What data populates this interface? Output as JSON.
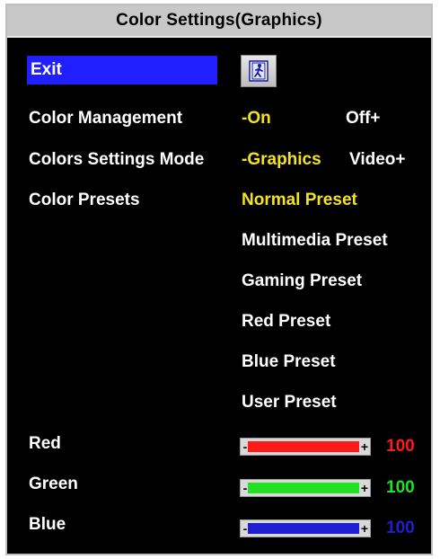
{
  "window": {
    "title": "Color Settings(Graphics)"
  },
  "menu": {
    "exit_label": "Exit",
    "exit_icon": "exit-door-icon",
    "color_management": {
      "label": "Color Management",
      "options": [
        "-On",
        "Off+"
      ],
      "selected": "-On"
    },
    "color_settings_mode": {
      "label": "Colors Settings Mode",
      "options": [
        "-Graphics",
        "Video+"
      ],
      "selected": "-Graphics"
    },
    "color_presets": {
      "label": "Color Presets",
      "options": [
        "Normal Preset",
        "Multimedia Preset",
        "Gaming Preset",
        "Red Preset",
        "Blue Preset",
        "User Preset"
      ],
      "selected": "Normal Preset"
    }
  },
  "rgb": {
    "red": {
      "label": "Red",
      "value": "100",
      "level": 1.0,
      "color": "#ff1a1a"
    },
    "green": {
      "label": "Green",
      "value": "100",
      "level": 1.0,
      "color": "#22e022"
    },
    "blue": {
      "label": "Blue",
      "value": "100",
      "level": 1.0,
      "color": "#1f1fcf"
    },
    "minus_glyph": "-",
    "plus_glyph": "+"
  },
  "colors": {
    "selected_text": "#f5e31c",
    "highlight": "#1f1fff",
    "background": "#000000",
    "title_bar": "#c8c8c8"
  }
}
